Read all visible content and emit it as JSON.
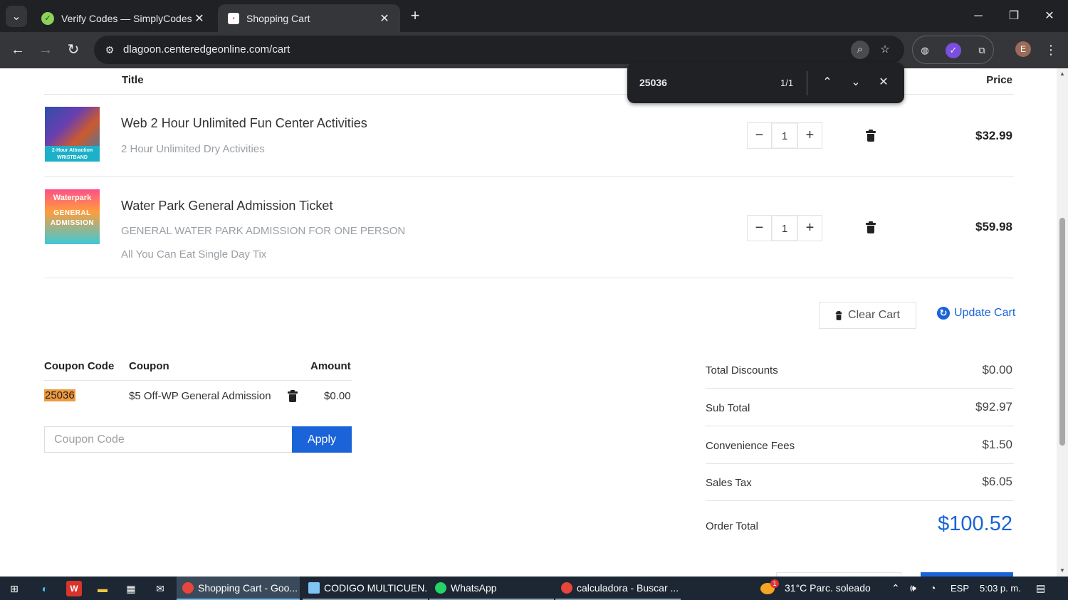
{
  "browser": {
    "tabs": [
      {
        "title": "Verify Codes — SimplyCodes",
        "active": false
      },
      {
        "title": "Shopping Cart",
        "active": true
      }
    ],
    "url": "dlagoon.centeredgeonline.com/cart",
    "profile_initial": "E",
    "find": {
      "query": "25036",
      "count": "1/1"
    }
  },
  "cart": {
    "headers": {
      "title": "Title",
      "price": "Price"
    },
    "items": [
      {
        "title": "Web 2 Hour Unlimited Fun Center Activities",
        "details": [
          "2 Hour Unlimited Dry Activities"
        ],
        "quantity": "1",
        "price": "$32.99",
        "image_text": [
          "2-Hour Attraction",
          "WRISTBAND"
        ]
      },
      {
        "title": "Water Park General Admission Ticket",
        "details": [
          "GENERAL WATER PARK ADMISSION FOR ONE PERSON",
          "All You Can Eat Single Day Tix"
        ],
        "quantity": "1",
        "price": "$59.98",
        "image_text": [
          "Waterpark",
          "GENERAL",
          "ADMISSION"
        ]
      }
    ],
    "clear_label": "Clear Cart",
    "update_label": "Update Cart"
  },
  "coupons": {
    "headers": {
      "code": "Coupon Code",
      "coupon": "Coupon",
      "amount": "Amount"
    },
    "rows": [
      {
        "code": "25036",
        "coupon": "$5 Off-WP General Admission",
        "amount": "$0.00"
      }
    ],
    "input_placeholder": "Coupon Code",
    "apply_label": "Apply"
  },
  "summary": {
    "rows": [
      {
        "label": "Total Discounts",
        "value": "$0.00"
      },
      {
        "label": "Sub Total",
        "value": "$92.97"
      },
      {
        "label": "Convenience Fees",
        "value": "$1.50"
      },
      {
        "label": "Sales Tax",
        "value": "$6.05"
      }
    ],
    "order_total_label": "Order Total",
    "order_total_value": "$100.52"
  },
  "taskbar": {
    "apps": [
      {
        "label": "Shopping Cart - Goo...",
        "state": "active"
      },
      {
        "label": "CODIGO MULTICUEN...",
        "state": "open"
      },
      {
        "label": "WhatsApp",
        "state": "open"
      },
      {
        "label": "calculadora - Buscar ...",
        "state": "open"
      }
    ],
    "weather": "31°C  Parc. soleado",
    "weather_badge": "1",
    "language": "ESP",
    "time": "5:03 p. m."
  },
  "colors": {
    "accent": "#1a63d8",
    "highlight": "#f19a3e",
    "chrome_dark": "#202124"
  }
}
